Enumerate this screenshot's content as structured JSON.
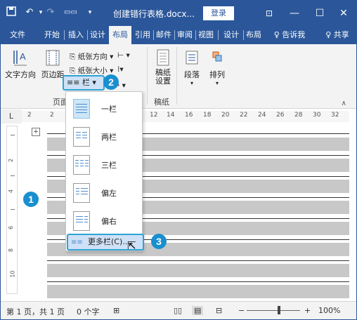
{
  "titlebar": {
    "save_icon": "save-icon",
    "undo_icon": "undo-icon",
    "redo_icon": "redo-icon",
    "doc_title": "创建错行表格.docx...",
    "login_label": "登录",
    "ribbon_display_icon": "ribbon-display-icon",
    "minimize": "—",
    "maximize": "☐",
    "close": "✕"
  },
  "tabs": [
    {
      "label": "文件"
    },
    {
      "label": "开始"
    },
    {
      "label": "插入"
    },
    {
      "label": "设计"
    },
    {
      "label": "布局"
    },
    {
      "label": "引用"
    },
    {
      "label": "邮件"
    },
    {
      "label": "审阅"
    },
    {
      "label": "视图"
    },
    {
      "label": "设计"
    },
    {
      "label": "布局"
    },
    {
      "label": "♀ 告诉我"
    },
    {
      "label": "♀ 共享"
    }
  ],
  "ribbon": {
    "text_direction": "文字方向",
    "margins": "页边距",
    "orientation": "纸张方向 ▾",
    "size": "纸张大小 ▾",
    "columns": "≡≡ 栏 ▾",
    "group_page_setup": "页面",
    "draft": "稿纸\n设置",
    "draft_label": "稿纸",
    "draft_group": "稿纸",
    "paragraph": "段落",
    "arrange": "排列"
  },
  "columns_menu": {
    "items": [
      {
        "label": "一栏"
      },
      {
        "label": "两栏"
      },
      {
        "label": "三栏"
      },
      {
        "label": "偏左"
      },
      {
        "label": "偏右"
      }
    ],
    "more": "更多栏(C)..."
  },
  "badges": {
    "b1": "1",
    "b2": "2",
    "b3": "3"
  },
  "ruler": {
    "corner": "L",
    "h_numbers": [
      "2",
      "2",
      "12",
      "14",
      "16",
      "18",
      "20",
      "22",
      "24",
      "26",
      "28",
      "30",
      "32"
    ],
    "v_numbers": [
      "2",
      "4",
      "6",
      "8",
      "10"
    ]
  },
  "status": {
    "page": "第 1 页，共 1 页",
    "words": "0 个字",
    "zoom": "100%"
  }
}
